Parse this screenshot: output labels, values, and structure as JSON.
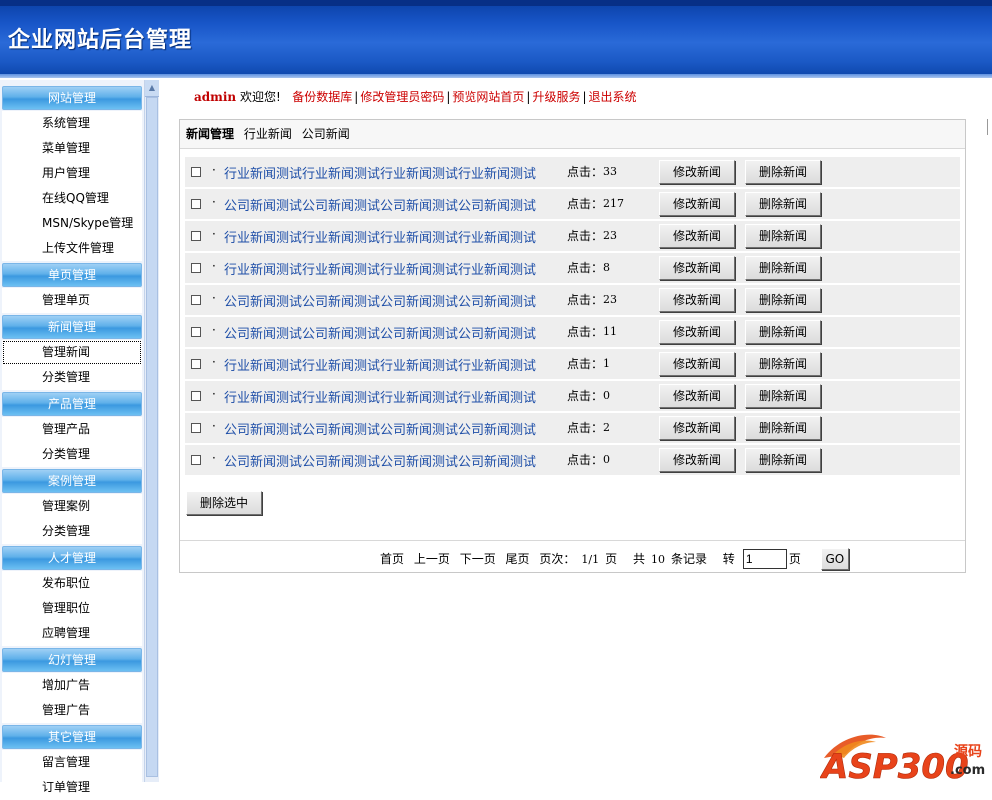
{
  "header": {
    "title": "企业网站后台管理"
  },
  "sidebar": {
    "groups": [
      {
        "title": "网站管理",
        "items": [
          "系统管理",
          "菜单管理",
          "用户管理",
          "在线QQ管理",
          "MSN/Skype管理",
          "上传文件管理"
        ]
      },
      {
        "title": "单页管理",
        "items": [
          "管理单页"
        ]
      },
      {
        "title": "新闻管理",
        "items": [
          "管理新闻",
          "分类管理"
        ]
      },
      {
        "title": "产品管理",
        "items": [
          "管理产品",
          "分类管理"
        ]
      },
      {
        "title": "案例管理",
        "items": [
          "管理案例",
          "分类管理"
        ]
      },
      {
        "title": "人才管理",
        "items": [
          "发布职位",
          "管理职位",
          "应聘管理"
        ]
      },
      {
        "title": "幻灯管理",
        "items": [
          "增加广告",
          "管理广告"
        ]
      },
      {
        "title": "其它管理",
        "items": [
          "留言管理",
          "订单管理"
        ]
      }
    ],
    "active_item": "管理新闻"
  },
  "topbar": {
    "user": "admin",
    "welcome": "欢迎您!",
    "links": [
      "备份数据库",
      "修改管理员密码",
      "预览网站首页",
      "升级服务",
      "退出系统"
    ],
    "separator": "|"
  },
  "panel": {
    "tabs": [
      "新闻管理",
      "行业新闻",
      "公司新闻"
    ],
    "hits_label": "点击：",
    "edit_label": "修改新闻",
    "delete_label": "删除新闻",
    "bullet": "·",
    "news": [
      {
        "title": "行业新闻测试行业新闻测试行业新闻测试行业新闻测试",
        "hits": "33"
      },
      {
        "title": "公司新闻测试公司新闻测试公司新闻测试公司新闻测试",
        "hits": "217"
      },
      {
        "title": "行业新闻测试行业新闻测试行业新闻测试行业新闻测试",
        "hits": "23"
      },
      {
        "title": "行业新闻测试行业新闻测试行业新闻测试行业新闻测试",
        "hits": "8"
      },
      {
        "title": "公司新闻测试公司新闻测试公司新闻测试公司新闻测试",
        "hits": "23"
      },
      {
        "title": "公司新闻测试公司新闻测试公司新闻测试公司新闻测试",
        "hits": "11"
      },
      {
        "title": "行业新闻测试行业新闻测试行业新闻测试行业新闻测试",
        "hits": "1"
      },
      {
        "title": "行业新闻测试行业新闻测试行业新闻测试行业新闻测试",
        "hits": "0"
      },
      {
        "title": "公司新闻测试公司新闻测试公司新闻测试公司新闻测试",
        "hits": "2"
      },
      {
        "title": "公司新闻测试公司新闻测试公司新闻测试公司新闻测试",
        "hits": "0"
      }
    ],
    "delete_selected": "删除选中"
  },
  "pager": {
    "first": "首页",
    "prev": "上一页",
    "next": "下一页",
    "last": "尾页",
    "page_label": "页次：",
    "page_value": "1/1",
    "page_suffix": "页",
    "total_prefix": "共",
    "total_value": "10",
    "total_suffix": "条记录",
    "goto_label": "转",
    "page_input_value": "1",
    "goto_suffix": "页",
    "go_label": "GO"
  },
  "watermark": {
    "text": "ASP300",
    "suffix_top": "源码",
    "suffix_bottom": ".com"
  },
  "colors": {
    "header_blue": "#1856c8",
    "link_red": "#cc0000",
    "news_blue": "#1f4fa8",
    "menu_title": "#5fb0ea"
  }
}
